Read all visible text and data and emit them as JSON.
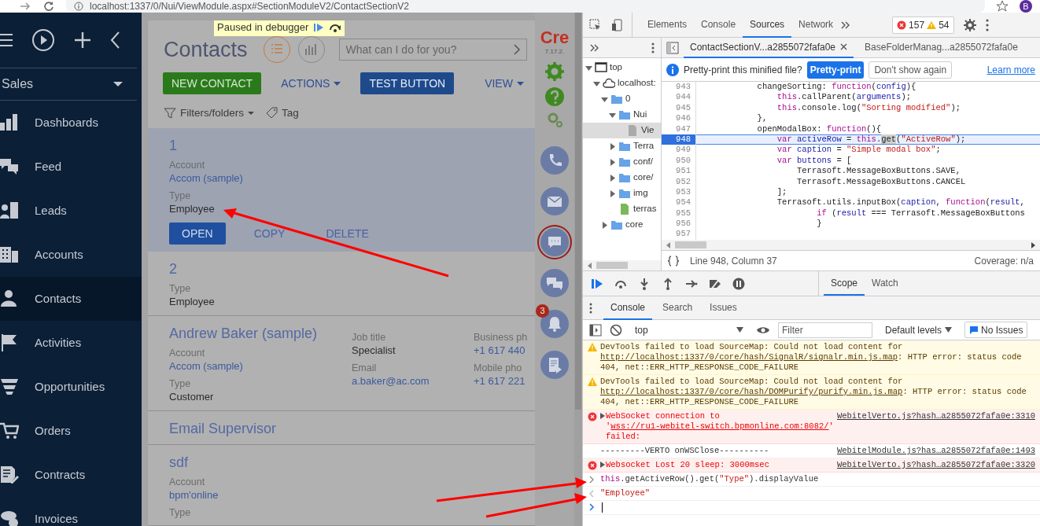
{
  "browser": {
    "url": "localhost:1337/0/Nui/ViewModule.aspx#SectionModuleV2/ContactSectionV2",
    "profile_initial": "B"
  },
  "sidebar": {
    "workplace": "Sales",
    "items": [
      {
        "label": "Dashboards",
        "selected": false
      },
      {
        "label": "Feed",
        "selected": false
      },
      {
        "label": "Leads",
        "selected": false
      },
      {
        "label": "Accounts",
        "selected": false
      },
      {
        "label": "Contacts",
        "selected": true
      },
      {
        "label": "Activities",
        "selected": false
      },
      {
        "label": "Opportunities",
        "selected": false
      },
      {
        "label": "Orders",
        "selected": false
      },
      {
        "label": "Contracts",
        "selected": false
      },
      {
        "label": "Invoices",
        "selected": false
      }
    ]
  },
  "section": {
    "title": "Contacts",
    "debugger_banner": "Paused in debugger",
    "view_modes": [
      {
        "selected": true
      },
      {
        "selected": false
      }
    ],
    "search": {
      "placeholder": "What can I do for you?"
    },
    "buttons": [
      {
        "label": "NEW CONTACT",
        "kind": "green"
      },
      {
        "label": "ACTIONS",
        "kind": "menu"
      },
      {
        "label": "TEST BUTTON",
        "kind": "blue"
      },
      {
        "label": "VIEW",
        "kind": "menu"
      }
    ],
    "filters": "Filters/folders",
    "tag": "Tag",
    "records": [
      {
        "title": "1",
        "selected": true,
        "columns": [
          [
            {
              "label": "Account",
              "value": "Accom (sample)",
              "link": true
            },
            {
              "label": "Type",
              "value": "Employee",
              "link": false
            }
          ]
        ],
        "actions": [
          {
            "label": "OPEN",
            "kind": "primary"
          },
          {
            "label": "COPY",
            "kind": "link"
          },
          {
            "label": "DELETE",
            "kind": "link"
          }
        ]
      },
      {
        "title": "2",
        "selected": false,
        "columns": [
          [
            {
              "label": "Type",
              "value": "Employee",
              "link": false
            }
          ]
        ]
      },
      {
        "title": "Andrew Baker (sample)",
        "selected": false,
        "columns": [
          [
            {
              "label": "Account",
              "value": "Accom (sample)",
              "link": true
            },
            {
              "label": "Type",
              "value": "Customer",
              "link": false
            }
          ],
          [
            {
              "label": "Job title",
              "value": "Specialist",
              "link": false
            },
            {
              "label": "Email",
              "value": "a.baker@ac.com",
              "link": true
            }
          ],
          [
            {
              "label": "Business ph",
              "value": "+1 617 440",
              "link": true
            },
            {
              "label": "Mobile pho",
              "value": "+1 617 221",
              "link": true
            }
          ]
        ]
      },
      {
        "title": "Email Supervisor",
        "selected": false
      },
      {
        "title": "sdf",
        "selected": false,
        "columns": [
          [
            {
              "label": "Account",
              "value": "bpm'online",
              "link": true
            },
            {
              "label": "Type"
            }
          ]
        ]
      }
    ]
  },
  "side_panel": {
    "logo": "Cre",
    "version": "7.17.2.",
    "actions": [
      {
        "selected": false
      },
      {
        "selected": false
      },
      {
        "selected": true
      },
      {
        "selected": false
      },
      {
        "selected": false,
        "badge": "3"
      },
      {
        "selected": false
      }
    ]
  },
  "devtools": {
    "tabs": [
      {
        "label": "Elements",
        "selected": false
      },
      {
        "label": "Console",
        "selected": false
      },
      {
        "label": "Sources",
        "selected": true
      },
      {
        "label": "Network",
        "selected": false
      }
    ],
    "errors": "157",
    "warnings": "54",
    "navigator": [
      {
        "label": "top",
        "kind": "frame",
        "expanded": true,
        "selected": false,
        "children": [
          {
            "label": "localhost:",
            "kind": "cloud",
            "expanded": true,
            "selected": false,
            "children": [
              {
                "label": "0",
                "kind": "folder",
                "expanded": true,
                "selected": false,
                "children": [
                  {
                    "label": "Nui",
                    "kind": "folder",
                    "expanded": true,
                    "selected": false,
                    "children": [
                      {
                        "label": "Vie",
                        "kind": "file",
                        "selected": true
                      }
                    ]
                  },
                  {
                    "label": "Terra",
                    "kind": "folder",
                    "expanded": false,
                    "selected": false
                  },
                  {
                    "label": "conf/",
                    "kind": "folder",
                    "expanded": false,
                    "selected": false
                  },
                  {
                    "label": "core/",
                    "kind": "folder",
                    "expanded": false,
                    "selected": false
                  },
                  {
                    "label": "img",
                    "kind": "folder",
                    "expanded": false,
                    "selected": false
                  },
                  {
                    "label": "terras",
                    "kind": "script",
                    "selected": false
                  }
                ]
              },
              {
                "label": "core",
                "kind": "folder",
                "expanded": false,
                "selected": false
              }
            ]
          }
        ]
      }
    ],
    "file_tabs": [
      {
        "label": "ContactSectionV...a2855072fafa0e",
        "selected": true
      },
      {
        "label": "BaseFolderManag...a2855072fafa0e",
        "selected": false
      }
    ],
    "infobar": {
      "text": "Pretty-print this minified file?",
      "primary": "Pretty-print",
      "secondary": "Don't show again",
      "link": "Learn more"
    },
    "lines": [
      {
        "number": "943",
        "current": false,
        "tokens": [
          {
            "text": "            changeSorting: ",
            "kind": "plain"
          },
          {
            "text": "function",
            "kind": "kw"
          },
          {
            "text": "(",
            "kind": "plain"
          },
          {
            "text": "config",
            "kind": "var"
          },
          {
            "text": "){",
            "kind": "plain"
          }
        ]
      },
      {
        "number": "944",
        "current": false,
        "tokens": [
          {
            "text": "                this",
            "kind": "kw"
          },
          {
            "text": ".callParent(",
            "kind": "plain"
          },
          {
            "text": "arguments",
            "kind": "var"
          },
          {
            "text": ");",
            "kind": "plain"
          }
        ]
      },
      {
        "number": "945",
        "current": false,
        "tokens": [
          {
            "text": "                this",
            "kind": "kw"
          },
          {
            "text": ".console.log(",
            "kind": "plain"
          },
          {
            "text": "\"Sorting modified\"",
            "kind": "str"
          },
          {
            "text": ");",
            "kind": "plain"
          }
        ]
      },
      {
        "number": "946",
        "current": false,
        "tokens": [
          {
            "text": "            },",
            "kind": "plain"
          }
        ]
      },
      {
        "number": "947",
        "current": false,
        "tokens": [
          {
            "text": "            openModalBox: ",
            "kind": "plain"
          },
          {
            "text": "function",
            "kind": "kw"
          },
          {
            "text": "(){",
            "kind": "plain"
          }
        ]
      },
      {
        "number": "948",
        "current": true,
        "tokens": [
          {
            "text": "                var ",
            "kind": "kw"
          },
          {
            "text": "activeRow",
            "kind": "var"
          },
          {
            "text": " = ",
            "kind": "plain"
          },
          {
            "text": "this",
            "kind": "kw"
          },
          {
            "text": ".",
            "kind": "plain"
          },
          {
            "text": "get",
            "kind": "match"
          },
          {
            "text": "(",
            "kind": "plain"
          },
          {
            "text": "\"ActiveRow\"",
            "kind": "str"
          },
          {
            "text": ");",
            "kind": "plain"
          }
        ]
      },
      {
        "number": "949",
        "current": false,
        "tokens": [
          {
            "text": "                var ",
            "kind": "kw"
          },
          {
            "text": "caption",
            "kind": "var"
          },
          {
            "text": " = ",
            "kind": "plain"
          },
          {
            "text": "\"Simple modal box\"",
            "kind": "str"
          },
          {
            "text": ";",
            "kind": "plain"
          }
        ]
      },
      {
        "number": "950",
        "current": false,
        "tokens": [
          {
            "text": "                var ",
            "kind": "kw"
          },
          {
            "text": "buttons",
            "kind": "var"
          },
          {
            "text": " = [",
            "kind": "plain"
          }
        ]
      },
      {
        "number": "951",
        "current": false,
        "tokens": [
          {
            "text": "                    Terrasoft.MessageBoxButtons.SAVE,",
            "kind": "plain"
          }
        ]
      },
      {
        "number": "952",
        "current": false,
        "tokens": [
          {
            "text": "                    Terrasoft.MessageBoxButtons.CANCEL",
            "kind": "plain"
          }
        ]
      },
      {
        "number": "953",
        "current": false,
        "tokens": [
          {
            "text": "                ];",
            "kind": "plain"
          }
        ]
      },
      {
        "number": "954",
        "current": false,
        "tokens": [
          {
            "text": "                Terrasoft.utils.inputBox(",
            "kind": "plain"
          },
          {
            "text": "caption",
            "kind": "var"
          },
          {
            "text": ", ",
            "kind": "plain"
          },
          {
            "text": "function",
            "kind": "kw"
          },
          {
            "text": "(",
            "kind": "plain"
          },
          {
            "text": "result",
            "kind": "var"
          },
          {
            "text": ",",
            "kind": "plain"
          }
        ]
      },
      {
        "number": "955",
        "current": false,
        "tokens": [
          {
            "text": "                        if",
            "kind": "kw"
          },
          {
            "text": " (",
            "kind": "plain"
          },
          {
            "text": "result",
            "kind": "var"
          },
          {
            "text": " === Terrasoft.MessageBoxButtons",
            "kind": "plain"
          }
        ]
      },
      {
        "number": "956",
        "current": false,
        "tokens": [
          {
            "text": "                        }",
            "kind": "plain"
          }
        ]
      },
      {
        "number": "957",
        "current": false
      }
    ],
    "status": {
      "position": "Line 948, Column 37",
      "coverage": "Coverage: n/a"
    },
    "debugger_tabs": [
      {
        "label": "Scope",
        "selected": true
      },
      {
        "label": "Watch",
        "selected": false
      }
    ],
    "drawer_tabs": [
      {
        "label": "Console",
        "selected": true
      },
      {
        "label": "Search",
        "selected": false
      },
      {
        "label": "Issues",
        "selected": false
      }
    ],
    "console_toolbar": {
      "context": "top",
      "filter_placeholder": "Filter",
      "levels": "Default levels",
      "issues": "No Issues"
    },
    "messages": [
      {
        "kind": "warning",
        "expandable": false,
        "parts": [
          {
            "text": "DevTools failed to load SourceMap: Could not load content for ",
            "kind": "plain"
          },
          {
            "text": "http://localhost:1337/0/core/hash/SignalR/signalr.min.js.map",
            "kind": "link"
          },
          {
            "text": ": HTTP error: status code 404, net::ERR_HTTP_RESPONSE_CODE_FAILURE",
            "kind": "plain"
          }
        ]
      },
      {
        "kind": "warning",
        "expandable": false,
        "parts": [
          {
            "text": "DevTools failed to load SourceMap: Could not load content for ",
            "kind": "plain"
          },
          {
            "text": "http://localhost:1337/0/core/hash/DOMPurify/purify.min.js.map",
            "kind": "link"
          },
          {
            "text": ": HTTP error: status code 404, net::ERR_HTTP_RESPONSE_CODE_FAILURE",
            "kind": "plain"
          }
        ]
      },
      {
        "kind": "error",
        "expandable": true,
        "parts": [
          {
            "text": "WebSocket connection to '",
            "kind": "plain"
          },
          {
            "text": "wss://ru1-webitel-switch.bpmonline.com:8082/",
            "kind": "link"
          },
          {
            "text": "' failed:",
            "kind": "plain"
          }
        ],
        "source": "WebitelVerto.js?hash…a2855072fafa0e:3310"
      },
      {
        "kind": "log",
        "expandable": false,
        "parts": [
          {
            "text": "---------VERTO onWSClose----------",
            "kind": "plain"
          }
        ],
        "source": "WebitelModule.js?has…a2855072fafa0e:1493"
      },
      {
        "kind": "error",
        "expandable": true,
        "parts": [
          {
            "text": "Websocket Lost 20 sleep: 3000msec",
            "kind": "plain"
          }
        ],
        "source": "WebitelVerto.js?hash…a2855072fafa0e:3320"
      },
      {
        "kind": "input",
        "expandable": false,
        "parts": [
          {
            "text": "this",
            "kind": "kw"
          },
          {
            "text": ".getActiveRow().get(",
            "kind": "plain"
          },
          {
            "text": "\"Type\"",
            "kind": "str"
          },
          {
            "text": ").displayValue",
            "kind": "plain"
          }
        ]
      },
      {
        "kind": "result",
        "expandable": false,
        "parts": [
          {
            "text": "\"Employee\"",
            "kind": "str"
          }
        ]
      }
    ]
  }
}
